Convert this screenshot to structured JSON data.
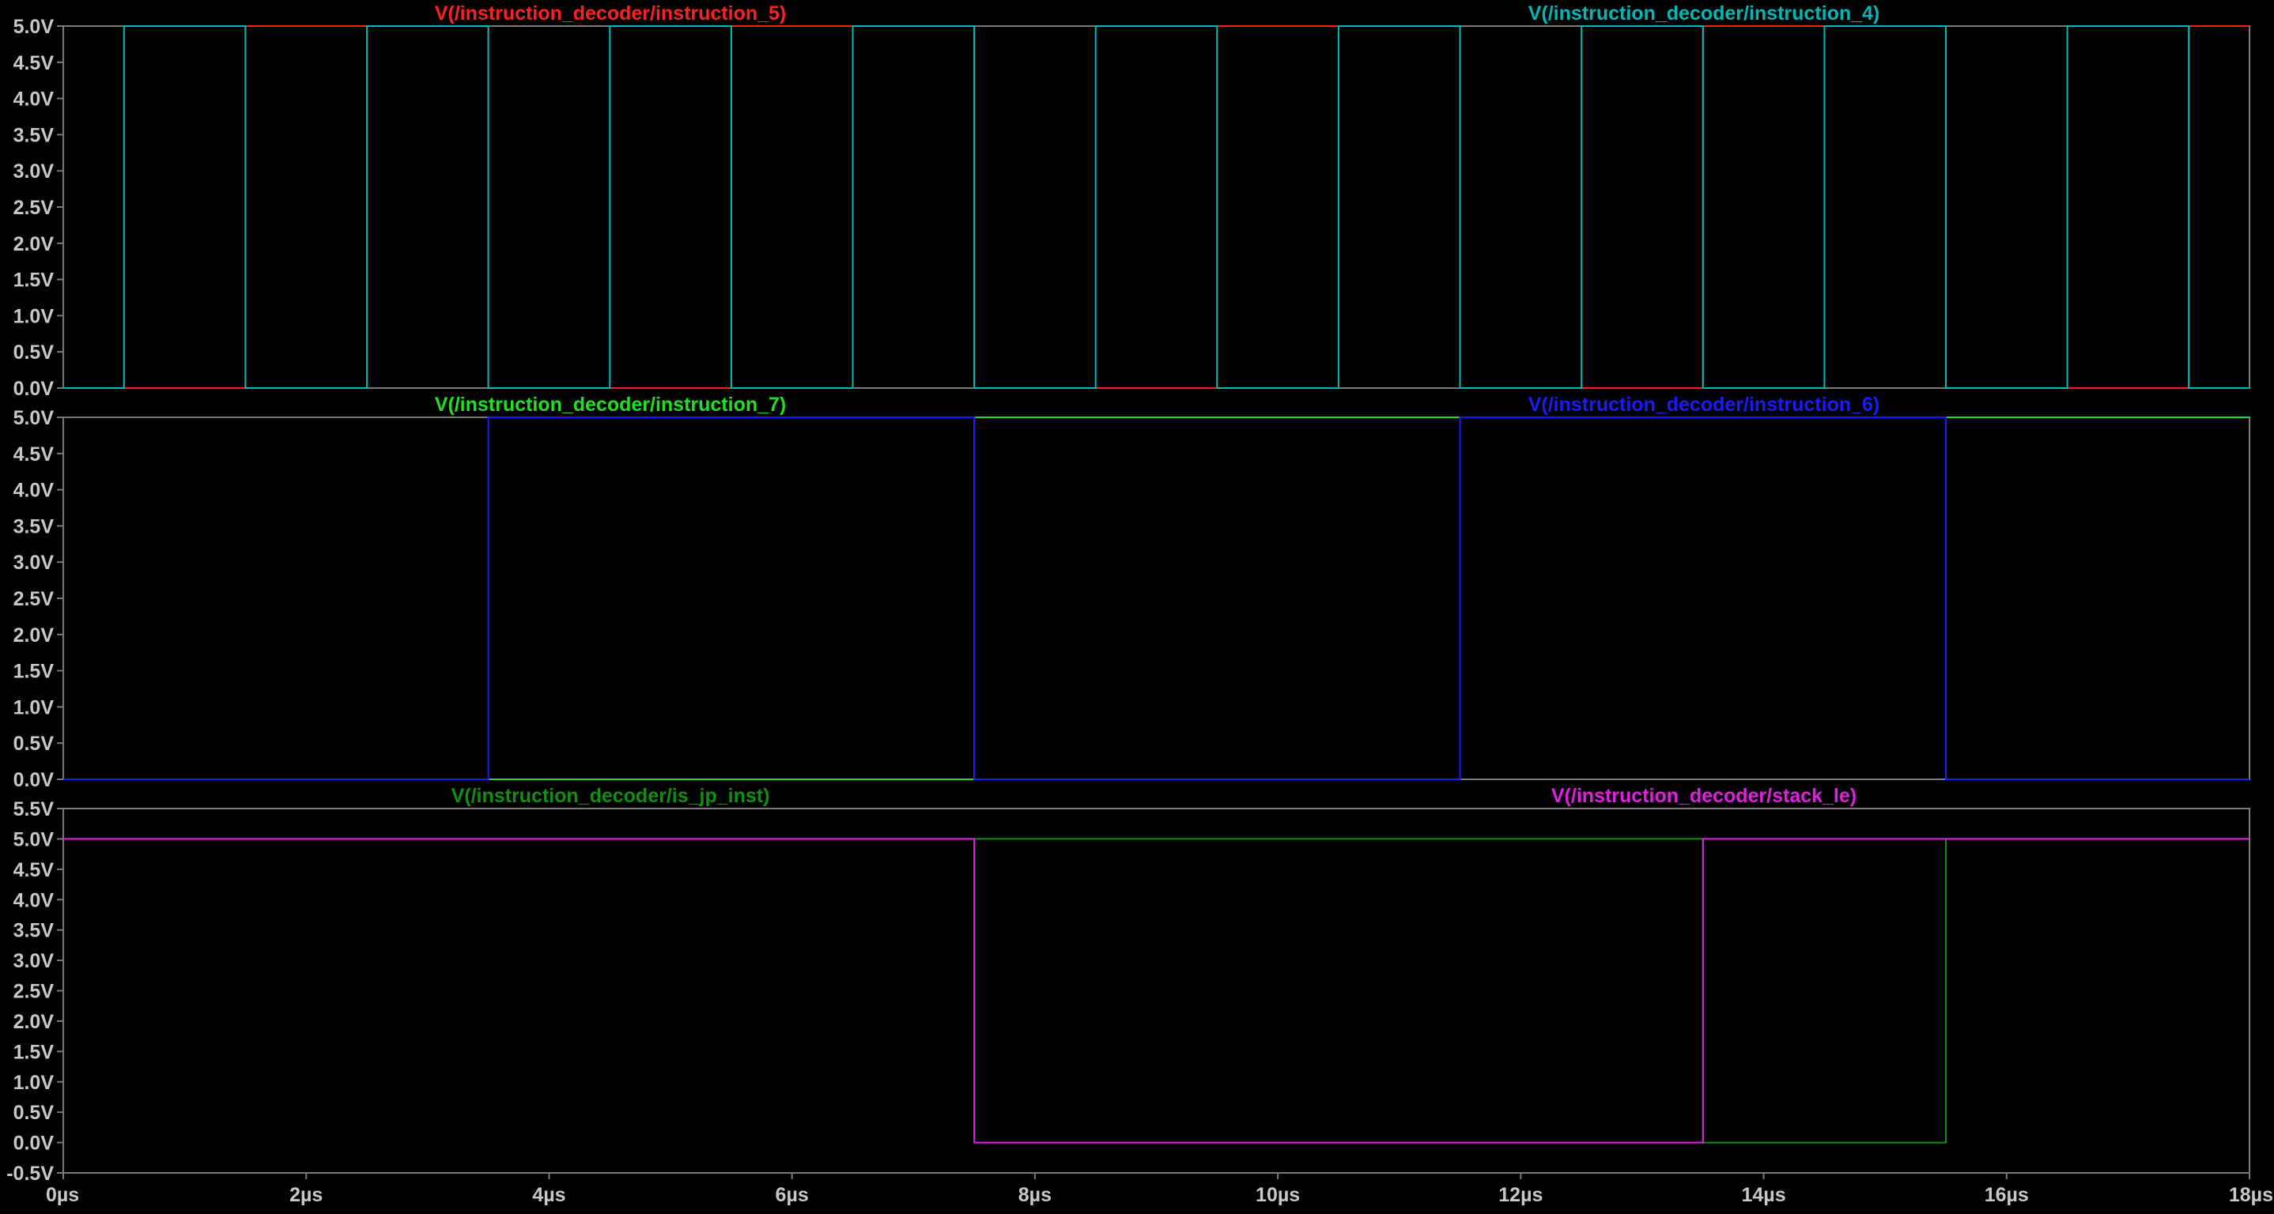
{
  "chart_data": {
    "type": "line",
    "x_unit": "µs",
    "xlim": [
      0,
      18
    ],
    "x_ticks": [
      0,
      2,
      4,
      6,
      8,
      10,
      12,
      14,
      16,
      18
    ],
    "x_tick_labels": [
      "0µs",
      "2µs",
      "4µs",
      "6µs",
      "8µs",
      "10µs",
      "12µs",
      "14µs",
      "16µs",
      "18µs"
    ],
    "panes": [
      {
        "ylim": [
          0,
          5
        ],
        "y_ticks": [
          0,
          0.5,
          1,
          1.5,
          2,
          2.5,
          3,
          3.5,
          4,
          4.5,
          5
        ],
        "y_tick_labels": [
          "0.0V",
          "0.5V",
          "1.0V",
          "1.5V",
          "2.0V",
          "2.5V",
          "3.0V",
          "3.5V",
          "4.0V",
          "4.5V",
          "5.0V"
        ],
        "series": [
          {
            "name": "V(/instruction_decoder/instruction_5)",
            "color": "#ff2020",
            "x": [
              0,
              1.5,
              1.5,
              3.5,
              3.5,
              5.5,
              5.5,
              7.5,
              7.5,
              9.5,
              9.5,
              11.5,
              11.5,
              13.5,
              13.5,
              15.5,
              15.5,
              17.5,
              17.5,
              18
            ],
            "y": [
              0,
              0,
              5,
              5,
              0,
              0,
              5,
              5,
              0,
              0,
              5,
              5,
              0,
              0,
              5,
              5,
              0,
              0,
              5,
              5
            ]
          },
          {
            "name": "V(/instruction_decoder/instruction_4)",
            "color": "#00b8b8",
            "x": [
              0,
              0.5,
              0.5,
              1.5,
              1.5,
              2.5,
              2.5,
              3.5,
              3.5,
              4.5,
              4.5,
              5.5,
              5.5,
              6.5,
              6.5,
              7.5,
              7.5,
              8.5,
              8.5,
              9.5,
              9.5,
              10.5,
              10.5,
              11.5,
              11.5,
              12.5,
              12.5,
              13.5,
              13.5,
              14.5,
              14.5,
              15.5,
              15.5,
              16.5,
              16.5,
              17.5,
              17.5,
              18
            ],
            "y": [
              0,
              0,
              5,
              5,
              0,
              0,
              5,
              5,
              0,
              0,
              5,
              5,
              0,
              0,
              5,
              5,
              0,
              0,
              5,
              5,
              0,
              0,
              5,
              5,
              0,
              0,
              5,
              5,
              0,
              0,
              5,
              5,
              0,
              0,
              5,
              5,
              0,
              0
            ]
          }
        ]
      },
      {
        "ylim": [
          0,
          5
        ],
        "y_ticks": [
          0,
          0.5,
          1,
          1.5,
          2,
          2.5,
          3,
          3.5,
          4,
          4.5,
          5
        ],
        "y_tick_labels": [
          "0.0V",
          "0.5V",
          "1.0V",
          "1.5V",
          "2.0V",
          "2.5V",
          "3.0V",
          "3.5V",
          "4.0V",
          "4.5V",
          "5.0V"
        ],
        "series": [
          {
            "name": "V(/instruction_decoder/instruction_7)",
            "color": "#20e020",
            "x": [
              0,
              7.5,
              7.5,
              18
            ],
            "y": [
              0,
              0,
              5,
              5
            ]
          },
          {
            "name": "V(/instruction_decoder/instruction_6)",
            "color": "#1a1aff",
            "x": [
              0,
              3.5,
              3.5,
              7.5,
              7.5,
              11.5,
              11.5,
              15.5,
              15.5,
              18
            ],
            "y": [
              0,
              0,
              5,
              5,
              0,
              0,
              5,
              5,
              0,
              0
            ]
          }
        ]
      },
      {
        "ylim": [
          -0.5,
          5.5
        ],
        "y_ticks": [
          -0.5,
          0,
          0.5,
          1,
          1.5,
          2,
          2.5,
          3,
          3.5,
          4,
          4.5,
          5,
          5.5
        ],
        "y_tick_labels": [
          "-0.5V",
          "0.0V",
          "0.5V",
          "1.0V",
          "1.5V",
          "2.0V",
          "2.5V",
          "3.0V",
          "3.5V",
          "4.0V",
          "4.5V",
          "5.0V",
          "5.5V"
        ],
        "series": [
          {
            "name": "V(/instruction_decoder/is_jp_inst)",
            "color": "#109010",
            "x": [
              0,
              13.5,
              13.5,
              15.5,
              15.5,
              18
            ],
            "y": [
              5,
              5,
              0,
              0,
              5,
              5
            ]
          },
          {
            "name": "V(/instruction_decoder/stack_le)",
            "color": "#e020e0",
            "x": [
              0,
              7.5,
              7.5,
              13.5,
              13.5,
              15.5,
              15.5,
              18
            ],
            "y": [
              5,
              5,
              0,
              0,
              5,
              5,
              5,
              5
            ]
          }
        ]
      }
    ],
    "grid": false,
    "legend_placement": "top"
  }
}
